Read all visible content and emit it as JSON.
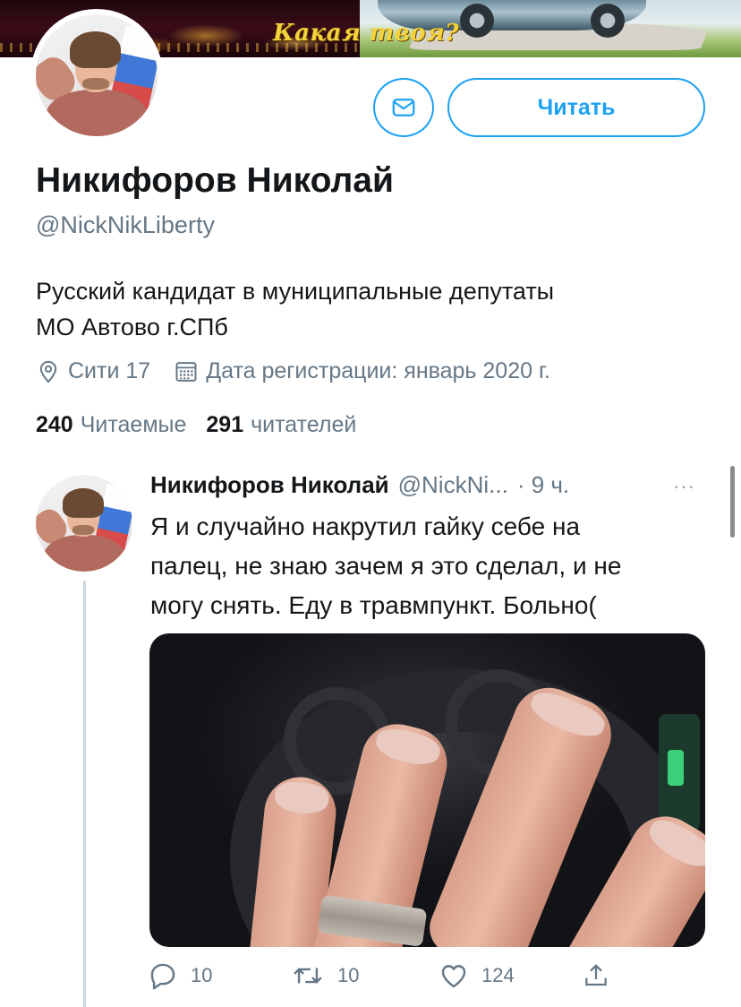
{
  "banner": {
    "caption": "Какая твоя?"
  },
  "header_actions": {
    "follow_label": "Читать"
  },
  "profile": {
    "display_name": "Никифоров Николай",
    "handle": "@NickNikLiberty",
    "bio_line1": "Русский кандидат в муниципальные депутаты",
    "bio_line2": "МО Автово г.СПб",
    "location": "Сити 17",
    "joined": "Дата регистрации: январь 2020 г.",
    "following_count": "240",
    "following_label": "Читаемые",
    "followers_count": "291",
    "followers_label": "читателей"
  },
  "tweet": {
    "author_name": "Никифоров Николай",
    "author_handle": "@NickNi...",
    "time": "· 9 ч.",
    "more": "···",
    "text_line1": "Я и случайно накрутил гайку себе на",
    "text_line2": "палец, не знаю зачем я это сделал, и не",
    "text_line3": "могу снять. Еду в травмпункт. Больно(",
    "reply_count": "10",
    "retweet_count": "10",
    "like_count": "124"
  },
  "colors": {
    "accent": "#1da1f2",
    "secondary_text": "#657786",
    "primary_text": "#14171a"
  },
  "icons": [
    "mail-icon",
    "location-pin-icon",
    "calendar-icon",
    "reply-icon",
    "retweet-icon",
    "like-icon",
    "share-icon",
    "more-icon"
  ]
}
